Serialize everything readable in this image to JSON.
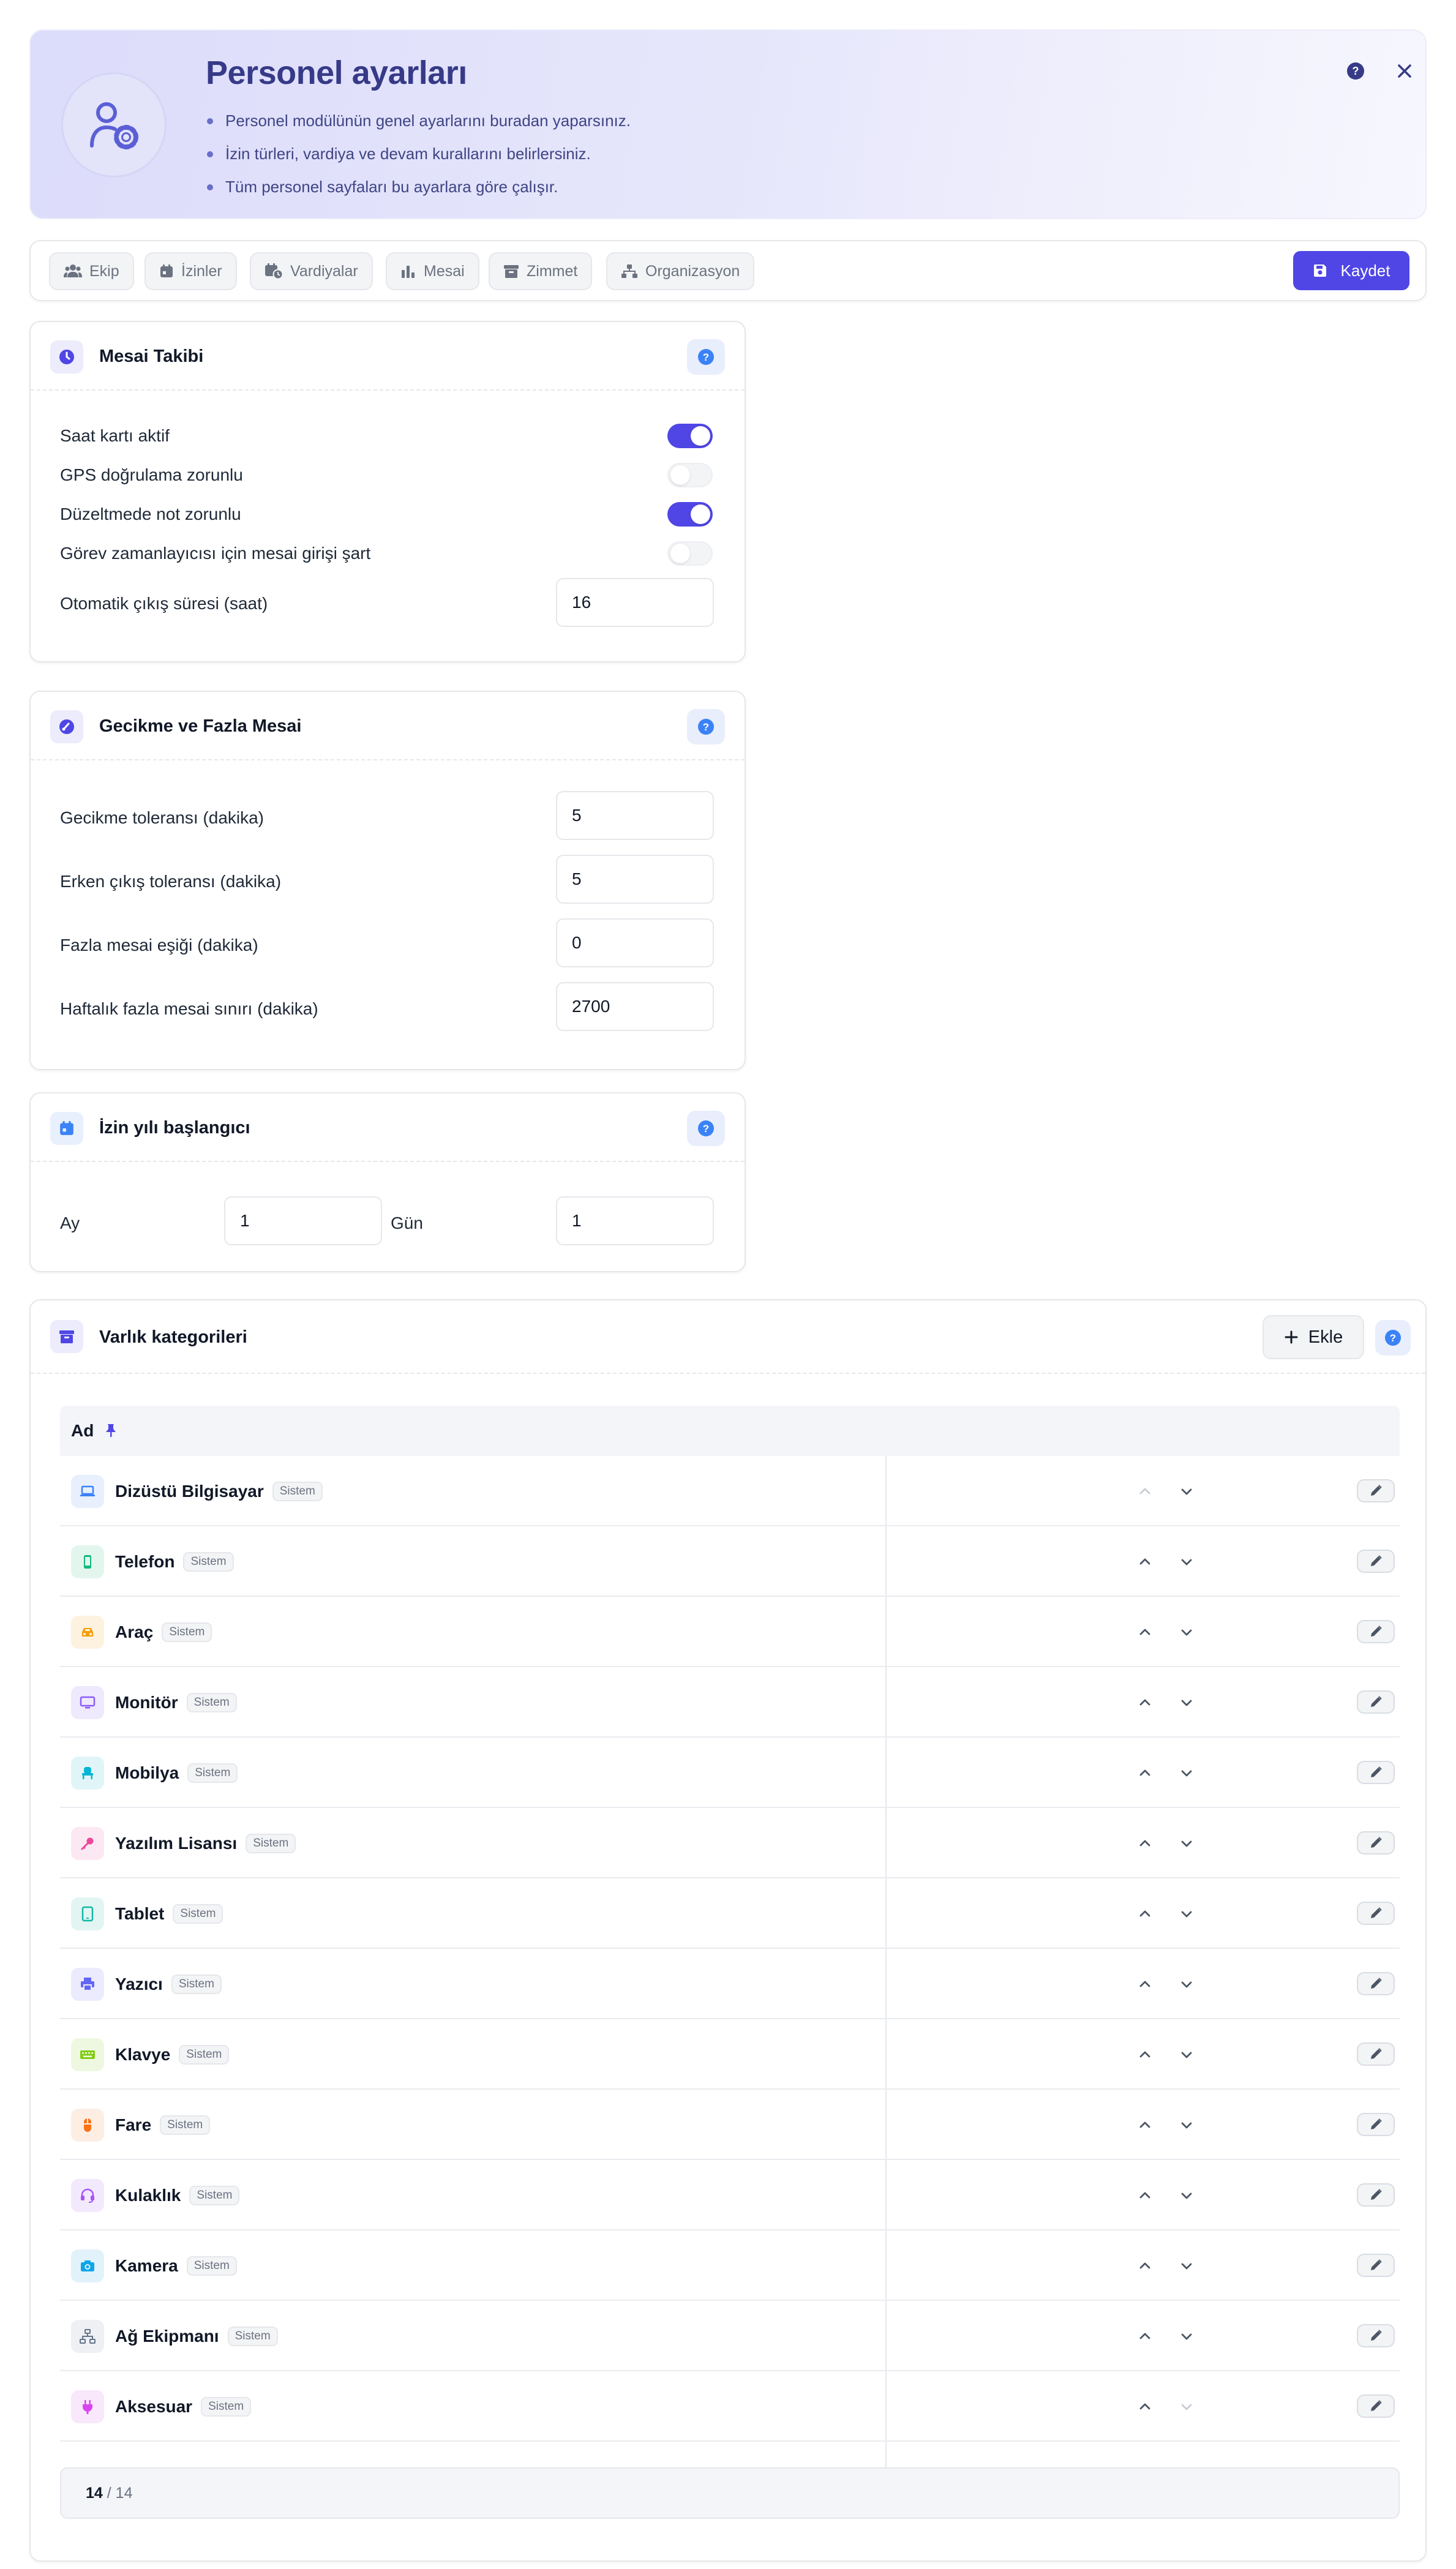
{
  "header": {
    "title": "Personel ayarları",
    "bullets": [
      "Personel modülünün genel ayarlarını buradan yaparsınız.",
      "İzin türleri, vardiya ve devam kurallarını belirlersiniz.",
      "Tüm personel sayfaları bu ayarlara göre çalışır."
    ]
  },
  "tabs": [
    {
      "label": "Ekip",
      "icon": "users-icon"
    },
    {
      "label": "İzinler",
      "icon": "calendar-icon"
    },
    {
      "label": "Vardiyalar",
      "icon": "calendar-clock-icon"
    },
    {
      "label": "Mesai",
      "icon": "bar-chart-icon"
    },
    {
      "label": "Zimmet",
      "icon": "archive-icon"
    },
    {
      "label": "Organizasyon",
      "icon": "sitemap-icon"
    }
  ],
  "toolbar": {
    "save_label": "Kaydet"
  },
  "time_tracking": {
    "title": "Mesai Takibi",
    "toggles": [
      {
        "label": "Saat kartı aktif",
        "on": true
      },
      {
        "label": "GPS doğrulama zorunlu",
        "on": false
      },
      {
        "label": "Düzeltmede not zorunlu",
        "on": true
      },
      {
        "label": "Görev zamanlayıcısı için mesai girişi şart",
        "on": false
      }
    ],
    "auto_checkout_label": "Otomatik çıkış süresi (saat)",
    "auto_checkout_value": "16"
  },
  "lateness": {
    "title": "Gecikme ve Fazla Mesai",
    "fields": [
      {
        "label": "Gecikme toleransı (dakika)",
        "value": "5"
      },
      {
        "label": "Erken çıkış toleransı (dakika)",
        "value": "5"
      },
      {
        "label": "Fazla mesai eşiği (dakika)",
        "value": "0"
      },
      {
        "label": "Haftalık fazla mesai sınırı (dakika)",
        "value": "2700"
      }
    ]
  },
  "leave_year": {
    "title": "İzin yılı başlangıcı",
    "month_label": "Ay",
    "month_value": "1",
    "day_label": "Gün",
    "day_value": "1"
  },
  "assets": {
    "title": "Varlık kategorileri",
    "add_label": "Ekle",
    "column_name": "Ad",
    "badge": "Sistem",
    "rows": [
      {
        "name": "Dizüstü Bilgisayar",
        "icon": "laptop-icon",
        "color": "#3b82f6",
        "bg": "#e8f0fd"
      },
      {
        "name": "Telefon",
        "icon": "phone-icon",
        "color": "#10b981",
        "bg": "#e3f6ee"
      },
      {
        "name": "Araç",
        "icon": "car-icon",
        "color": "#f59e0b",
        "bg": "#fdf2e0"
      },
      {
        "name": "Monitör",
        "icon": "monitor-icon",
        "color": "#8b5cf6",
        "bg": "#efe9fd"
      },
      {
        "name": "Mobilya",
        "icon": "chair-icon",
        "color": "#06b6d4",
        "bg": "#e1f5f9"
      },
      {
        "name": "Yazılım Lisansı",
        "icon": "key-icon",
        "color": "#ec4899",
        "bg": "#fce8f2"
      },
      {
        "name": "Tablet",
        "icon": "tablet-icon",
        "color": "#14b8a6",
        "bg": "#e2f5f3"
      },
      {
        "name": "Yazıcı",
        "icon": "printer-icon",
        "color": "#6366f1",
        "bg": "#ebebfd"
      },
      {
        "name": "Klavye",
        "icon": "keyboard-icon",
        "color": "#84cc16",
        "bg": "#eef8e1"
      },
      {
        "name": "Fare",
        "icon": "mouse-icon",
        "color": "#f97316",
        "bg": "#fdeee3"
      },
      {
        "name": "Kulaklık",
        "icon": "headset-icon",
        "color": "#a855f7",
        "bg": "#f3e9fd"
      },
      {
        "name": "Kamera",
        "icon": "camera-icon",
        "color": "#0ea5e9",
        "bg": "#e1f2fb"
      },
      {
        "name": "Ağ Ekipmanı",
        "icon": "network-icon",
        "color": "#64748b",
        "bg": "#eef0f3"
      },
      {
        "name": "Aksesuar",
        "icon": "plug-icon",
        "color": "#d946ef",
        "bg": "#f9e7fc"
      }
    ],
    "pager": {
      "current": "14",
      "separator": "/",
      "total": "14"
    }
  },
  "colors": {
    "accent": "#4f46e5",
    "help": "#3b82f6",
    "title": "#363a87"
  }
}
